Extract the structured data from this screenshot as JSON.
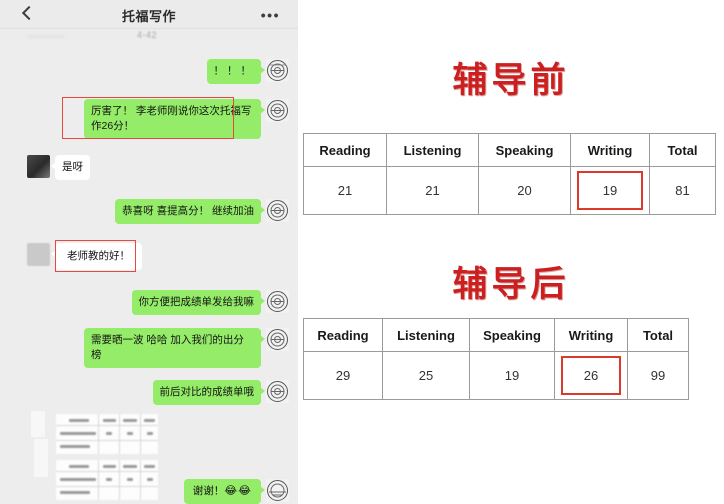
{
  "chat": {
    "header": {
      "title": "托福写作",
      "back_icon": "chevron-left-icon",
      "menu_icon": "more-options-icon",
      "blurred_timestamp": "4-42"
    },
    "messages": [
      {
        "id": "m1",
        "side": "right",
        "text": "！！！",
        "bubble": "green",
        "highlighted": false
      },
      {
        "id": "m2",
        "side": "right",
        "text": "厉害了！ 李老师刚说你这次托福写作26分！",
        "bubble": "green",
        "highlighted": true
      },
      {
        "id": "m3",
        "side": "left",
        "text": "是呀",
        "bubble": "white",
        "highlighted": false
      },
      {
        "id": "m4",
        "side": "right",
        "text": "恭喜呀 喜提高分！ 继续加油",
        "bubble": "green",
        "highlighted": false
      },
      {
        "id": "m5",
        "side": "left",
        "text": "老师教的好！",
        "bubble": "white",
        "highlighted": true
      },
      {
        "id": "m6",
        "side": "right",
        "text": "你方便把成绩单发给我嘛",
        "bubble": "green",
        "highlighted": false
      },
      {
        "id": "m7",
        "side": "right",
        "text": "需要晒一波 哈哈 加入我们的出分榜",
        "bubble": "green",
        "highlighted": false
      },
      {
        "id": "m8",
        "side": "right",
        "text": "前后对比的成绩单哦",
        "bubble": "green",
        "highlighted": false
      },
      {
        "id": "m9",
        "side": "right",
        "text": "谢谢！",
        "bubble": "green",
        "highlighted": false,
        "emoji": "😂😂"
      }
    ],
    "attachments": [
      {
        "id": "a1",
        "kind": "score-report-screenshot",
        "description": "blurred score report image"
      },
      {
        "id": "a2",
        "kind": "score-report-screenshot",
        "description": "blurred score report image"
      }
    ]
  },
  "report": {
    "before": {
      "title": "辅导前",
      "columns": [
        "Reading",
        "Listening",
        "Speaking",
        "Writing",
        "Total"
      ],
      "values": [
        "21",
        "21",
        "20",
        "19",
        "81"
      ],
      "highlight_column": "Writing",
      "highlight_value": "19"
    },
    "after": {
      "title": "辅导后",
      "columns": [
        "Reading",
        "Listening",
        "Speaking",
        "Writing",
        "Total"
      ],
      "values": [
        "29",
        "25",
        "19",
        "26",
        "99"
      ],
      "highlight_column": "Writing",
      "highlight_value": "26"
    }
  },
  "colors": {
    "title_red": "#cc1f1f",
    "highlight_red": "#d93a2b",
    "bubble_green": "#95ec69",
    "chat_background": "#ededed"
  }
}
